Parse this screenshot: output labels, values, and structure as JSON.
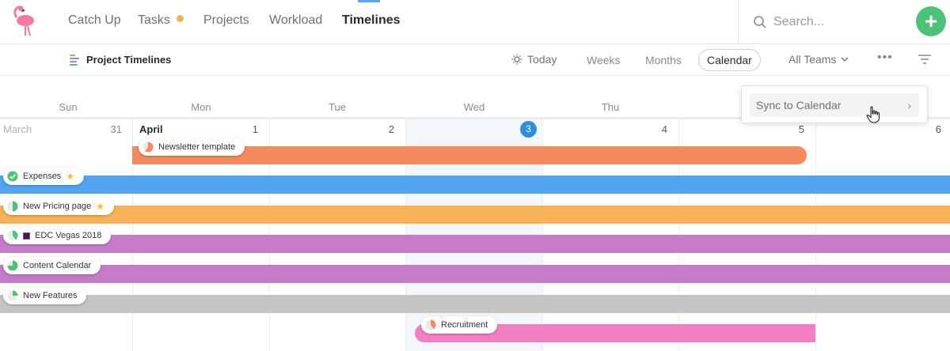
{
  "nav": {
    "items": [
      {
        "label": "Catch Up"
      },
      {
        "label": "Tasks"
      },
      {
        "label": "Projects"
      },
      {
        "label": "Workload"
      },
      {
        "label": "Timelines"
      }
    ],
    "search_placeholder": "Search...",
    "add_label": "+"
  },
  "subheader": {
    "title": "Project Timelines",
    "today": "Today",
    "weeks": "Weeks",
    "months": "Months",
    "calendar": "Calendar",
    "teams": "All Teams",
    "more": "•••"
  },
  "calendar": {
    "weekdays": [
      "Sun",
      "Mon",
      "Tue",
      "Wed",
      "Thu"
    ],
    "prev_month": "March",
    "cur_month": "April",
    "dates": [
      "31",
      "1",
      "2",
      "3",
      "4",
      "5",
      "6"
    ]
  },
  "timelines": [
    {
      "label": "Newsletter template",
      "color": "#f58a5c",
      "progress": 0.6
    },
    {
      "label": "Expenses",
      "color": "#52a3f0",
      "progress": 1.0,
      "starred": true
    },
    {
      "label": "New Pricing page",
      "color": "#f7b156",
      "progress": 0.5,
      "starred": true
    },
    {
      "label": "EDC Vegas 2018",
      "color": "#c57bc7",
      "progress": 0.4
    },
    {
      "label": "Content Calendar",
      "color": "#c57bc7",
      "progress": 0.75
    },
    {
      "label": "New Features",
      "color": "#c4c4c4",
      "progress": 0.25
    },
    {
      "label": "Recruitment",
      "color": "#f17fc4",
      "progress": 0.4
    }
  ],
  "dropdown": {
    "item": "Sync to Calendar",
    "chevron": "›"
  },
  "colors": {
    "accent_green": "#4dc27a",
    "today_blue": "#2f8fdd"
  }
}
